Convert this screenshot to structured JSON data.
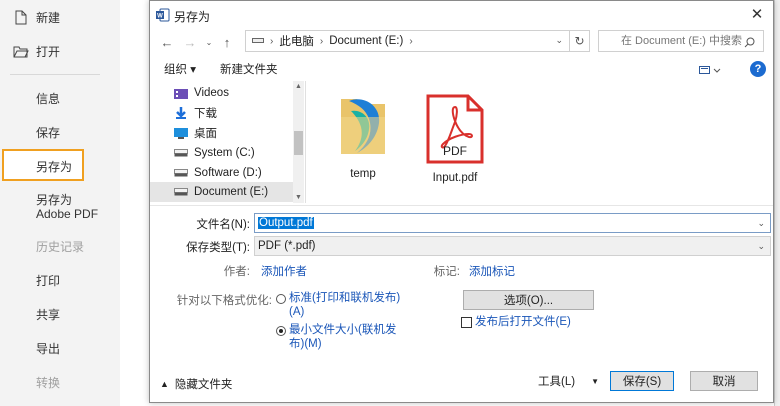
{
  "backstage": {
    "new": "新建",
    "open": "打开",
    "info": "信息",
    "save": "保存",
    "save_as": "另存为",
    "save_as_adobe_1": "另存为",
    "save_as_adobe_2": "Adobe PDF",
    "history": "历史记录",
    "print": "打印",
    "share": "共享",
    "export": "导出",
    "convert": "转换"
  },
  "dialog": {
    "title": "另存为",
    "close_icon": "close-icon",
    "address": {
      "this_pc": "此电脑",
      "drive": "Document (E:)"
    },
    "search_placeholder": "在 Document (E:) 中搜索",
    "toolbar": {
      "organize": "组织 ▾",
      "new_folder": "新建文件夹"
    },
    "nav_items": [
      {
        "label": "Videos",
        "icon": "video-folder-icon"
      },
      {
        "label": "下载",
        "icon": "download-icon"
      },
      {
        "label": "桌面",
        "icon": "desktop-icon"
      },
      {
        "label": "System (C:)",
        "icon": "drive-icon"
      },
      {
        "label": "Software (D:)",
        "icon": "drive-icon"
      },
      {
        "label": "Document (E:)",
        "icon": "drive-icon"
      }
    ],
    "files": [
      {
        "name": "temp",
        "icon": "folder-icon"
      },
      {
        "name": "Input.pdf",
        "icon": "pdf-file-icon",
        "badge": "PDF"
      }
    ],
    "filename_label": "文件名(N):",
    "filename_value": "Output.pdf",
    "filetype_label": "保存类型(T):",
    "filetype_value": "PDF (*.pdf)",
    "author_label": "作者:",
    "author_link": "添加作者",
    "tags_label": "标记:",
    "tags_link": "添加标记",
    "optimize_label": "针对以下格式优化:",
    "option_standard_1": "标准(打印和联机发布)",
    "option_standard_2": "(A)",
    "option_min_1": "最小文件大小(联机发",
    "option_min_2": "布)(M)",
    "options_button": "选项(O)...",
    "open_after_publish": "发布后打开文件(E)",
    "hide_folders": "隐藏文件夹",
    "tools": "工具(L)",
    "save_button": "保存(S)",
    "cancel_button": "取消"
  },
  "colors": {
    "accent": "#0078d7",
    "selected_outline": "#f0a020",
    "link": "#1a56b8",
    "pdf_red": "#d9302c"
  }
}
